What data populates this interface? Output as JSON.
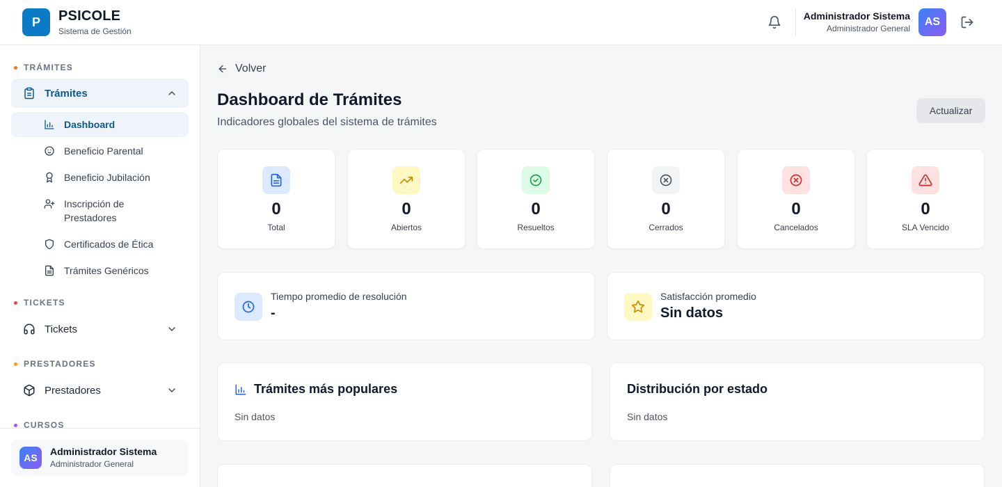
{
  "header": {
    "logo_letter": "P",
    "brand": "PSICOLE",
    "brand_sub": "Sistema de Gestión",
    "user_name": "Administrador Sistema",
    "user_role": "Administrador General",
    "avatar_initials": "AS"
  },
  "sidebar": {
    "sections": [
      {
        "label": "TRÁMITES",
        "color": "#f97316"
      },
      {
        "label": "TICKETS",
        "color": "#ef4444"
      },
      {
        "label": "PRESTADORES",
        "color": "#f59e0b"
      },
      {
        "label": "CURSOS",
        "color": "#a855f7"
      }
    ],
    "groups": {
      "tramites": "Trámites",
      "tickets": "Tickets",
      "prestadores": "Prestadores"
    },
    "items": [
      {
        "label": "Dashboard"
      },
      {
        "label": "Beneficio Parental"
      },
      {
        "label": "Beneficio Jubilación"
      },
      {
        "label": "Inscripción de Prestadores"
      },
      {
        "label": "Certificados de Ética"
      },
      {
        "label": "Trámites Genéricos"
      }
    ],
    "footer": {
      "initials": "AS",
      "name": "Administrador Sistema",
      "role": "Administrador General"
    }
  },
  "main": {
    "back_label": "Volver",
    "title": "Dashboard de Trámites",
    "subtitle": "Indicadores globales del sistema de trámites",
    "refresh_label": "Actualizar",
    "stats": [
      {
        "value": "0",
        "label": "Total"
      },
      {
        "value": "0",
        "label": "Abiertos"
      },
      {
        "value": "0",
        "label": "Resueltos"
      },
      {
        "value": "0",
        "label": "Cerrados"
      },
      {
        "value": "0",
        "label": "Cancelados"
      },
      {
        "value": "0",
        "label": "SLA Vencido"
      }
    ],
    "metrics": [
      {
        "label": "Tiempo promedio de resolución",
        "value": "-"
      },
      {
        "label": "Satisfacción promedio",
        "value": "Sin datos"
      }
    ],
    "panels": [
      {
        "title": "Trámites más populares",
        "empty": "Sin datos"
      },
      {
        "title": "Distribución por estado",
        "empty": "Sin datos"
      }
    ]
  },
  "colors": {
    "accent": "#0b7bc6",
    "active_bg": "#eef4fa",
    "active_text": "#0b5a8e"
  }
}
